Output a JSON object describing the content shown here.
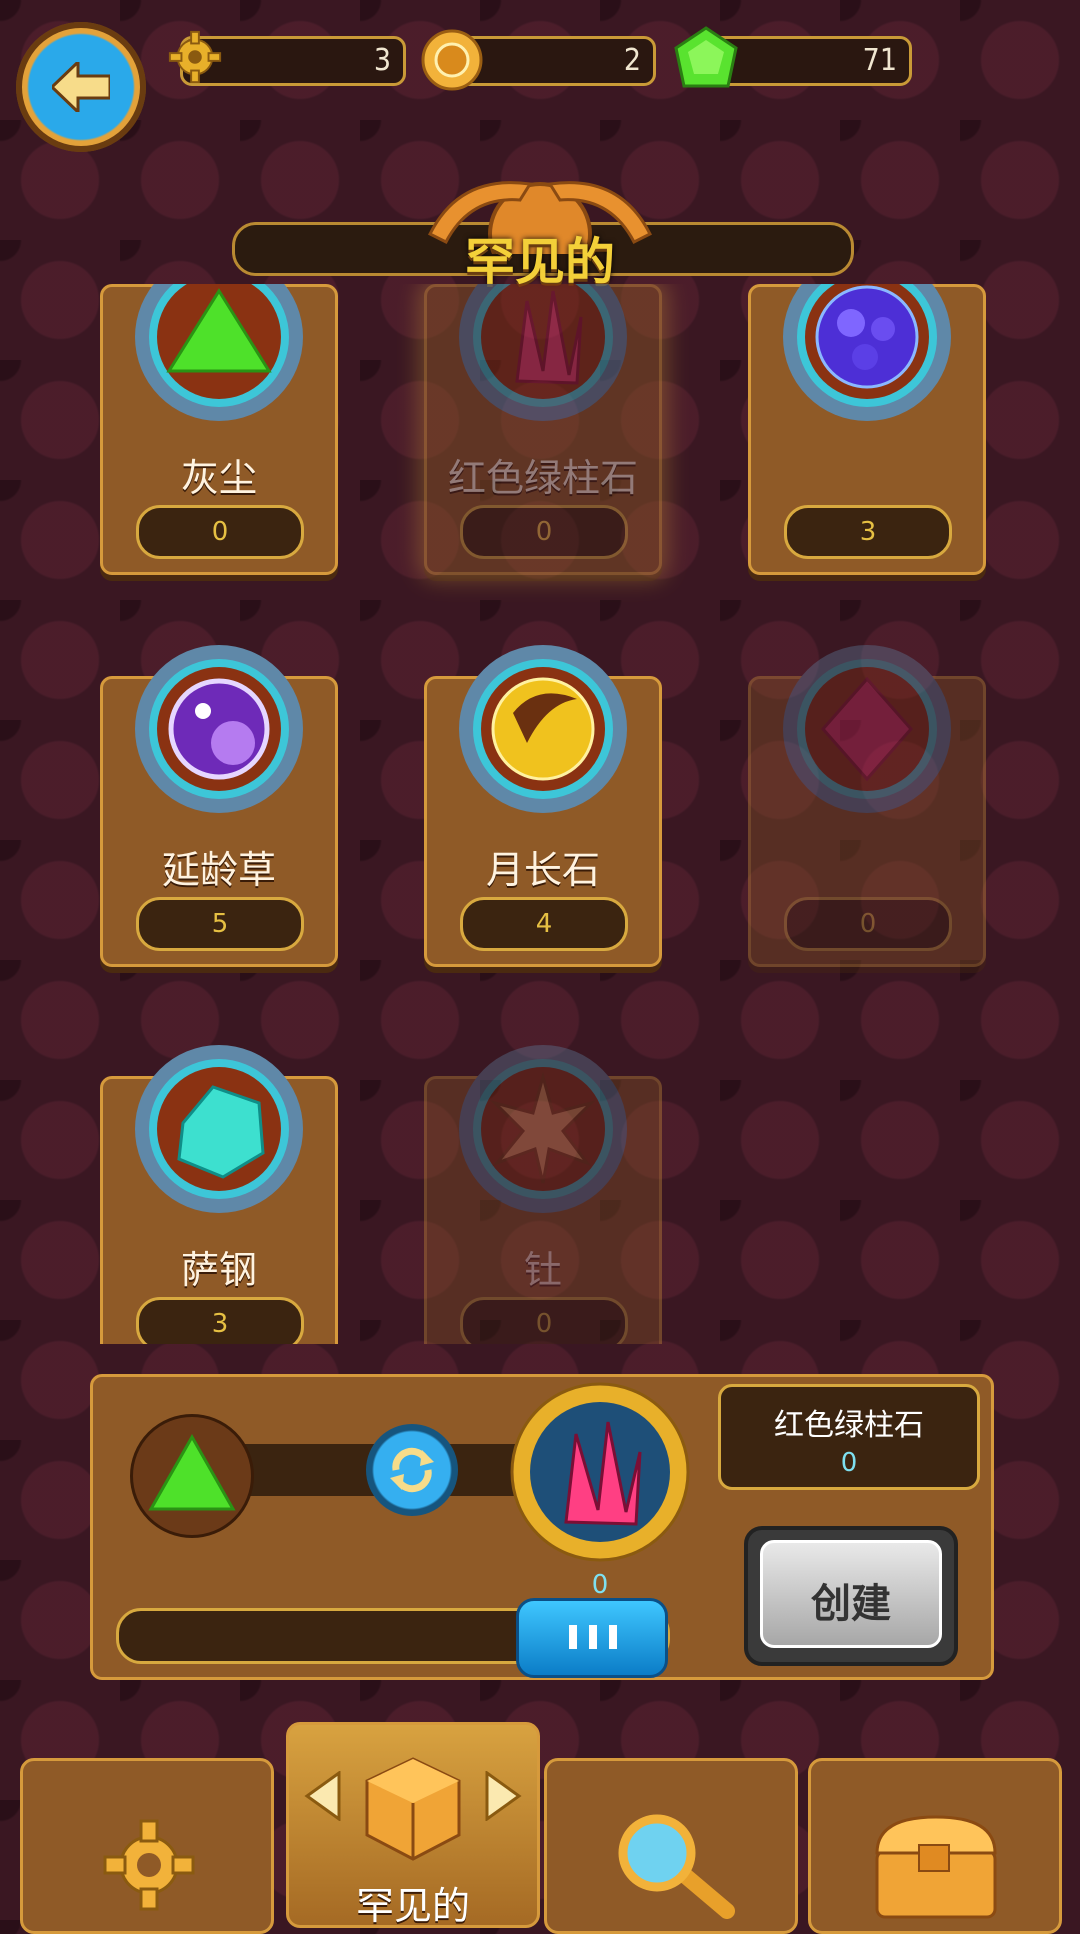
{
  "header": {
    "resources": [
      {
        "icon": "gear-icon",
        "value": "3"
      },
      {
        "icon": "gold-coin-icon",
        "value": "2"
      },
      {
        "icon": "green-gem-icon",
        "value": "71"
      }
    ]
  },
  "title": "罕见的",
  "items": [
    {
      "name": "灰尘",
      "count": "0",
      "icon": "green-dust-icon",
      "state": "normal"
    },
    {
      "name": "红色绿柱石",
      "count": "0",
      "icon": "red-crystal-icon",
      "state": "selected"
    },
    {
      "name": "",
      "count": "3",
      "icon": "blue-ore-icon",
      "state": "normal"
    },
    {
      "name": "延龄草",
      "count": "5",
      "icon": "purple-orb-icon",
      "state": "normal"
    },
    {
      "name": "月长石",
      "count": "4",
      "icon": "moonstone-icon",
      "state": "normal"
    },
    {
      "name": "",
      "count": "0",
      "icon": "pink-gem-icon",
      "state": "locked"
    },
    {
      "name": "萨钢",
      "count": "3",
      "icon": "cyan-crystal-icon",
      "state": "normal"
    },
    {
      "name": "钍",
      "count": "0",
      "icon": "thorium-icon",
      "state": "locked"
    }
  ],
  "craft": {
    "target_name": "红色绿柱石",
    "target_count": "0",
    "result_count": "0",
    "create_label": "创建"
  },
  "tabs": [
    {
      "icon": "gear-icon",
      "label": ""
    },
    {
      "icon": "dice-cube-icon",
      "label": "罕见的"
    },
    {
      "icon": "magnifier-icon",
      "label": ""
    },
    {
      "icon": "treasure-chest-icon",
      "label": ""
    }
  ],
  "colors": {
    "background": "#3a1722",
    "panel": "#8f5a27",
    "title": "#f3d039"
  }
}
